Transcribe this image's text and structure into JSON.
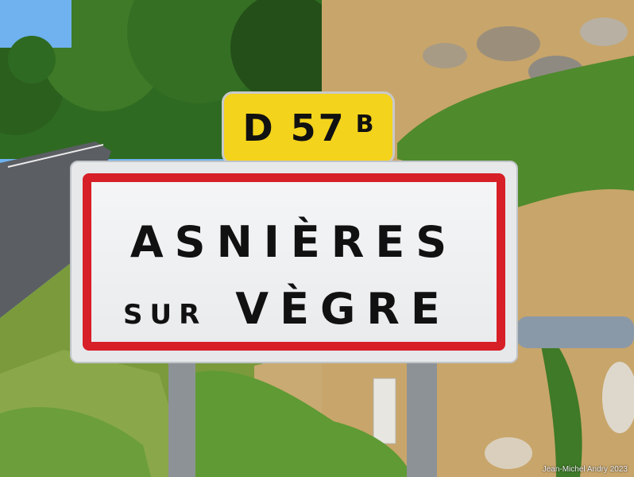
{
  "road_sign": {
    "number": "D 57",
    "suffix": "B"
  },
  "town_sign": {
    "line1": "ASNIÈRES",
    "line2_small": "SUR",
    "line2_big": "VÈGRE"
  },
  "credit": "Jean-Michel Andry 2023",
  "colors": {
    "sign_red": "#d71f27",
    "road_badge_yellow": "#f3d31b"
  }
}
